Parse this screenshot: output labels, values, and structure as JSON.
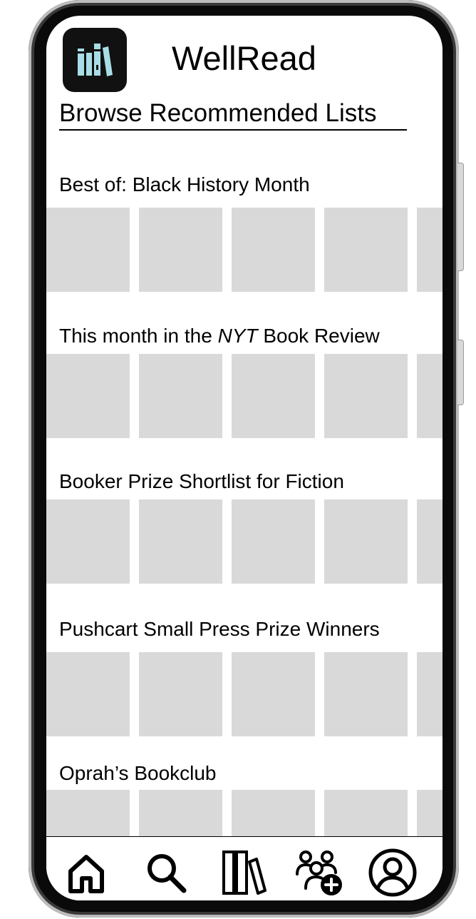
{
  "app": {
    "title": "WellRead",
    "logo_icon": "bookshelf-icon",
    "logo_bg": "#111111",
    "logo_accent": "#a8dde6"
  },
  "page": {
    "heading": "Browse Recommended Lists"
  },
  "lists": [
    {
      "title": "Best of: Black History Month",
      "books": 5
    },
    {
      "title_prefix": "This month in the ",
      "title_emph": "NYT",
      "title_suffix": " Book Review",
      "books": 5
    },
    {
      "title": "Booker Prize Shortlist for Fiction",
      "books": 5
    },
    {
      "title": "Pushcart Small Press Prize Winners",
      "books": 5
    },
    {
      "title": "Oprah’s Bookclub",
      "books": 5
    }
  ],
  "colors": {
    "placeholder": "#d9d9d9",
    "text": "#000000"
  },
  "nav": {
    "items": [
      {
        "icon": "home-icon",
        "label": "Home"
      },
      {
        "icon": "search-icon",
        "label": "Search"
      },
      {
        "icon": "library-icon",
        "label": "Library"
      },
      {
        "icon": "add-friends-icon",
        "label": "Add friends"
      },
      {
        "icon": "profile-icon",
        "label": "Profile"
      }
    ]
  }
}
